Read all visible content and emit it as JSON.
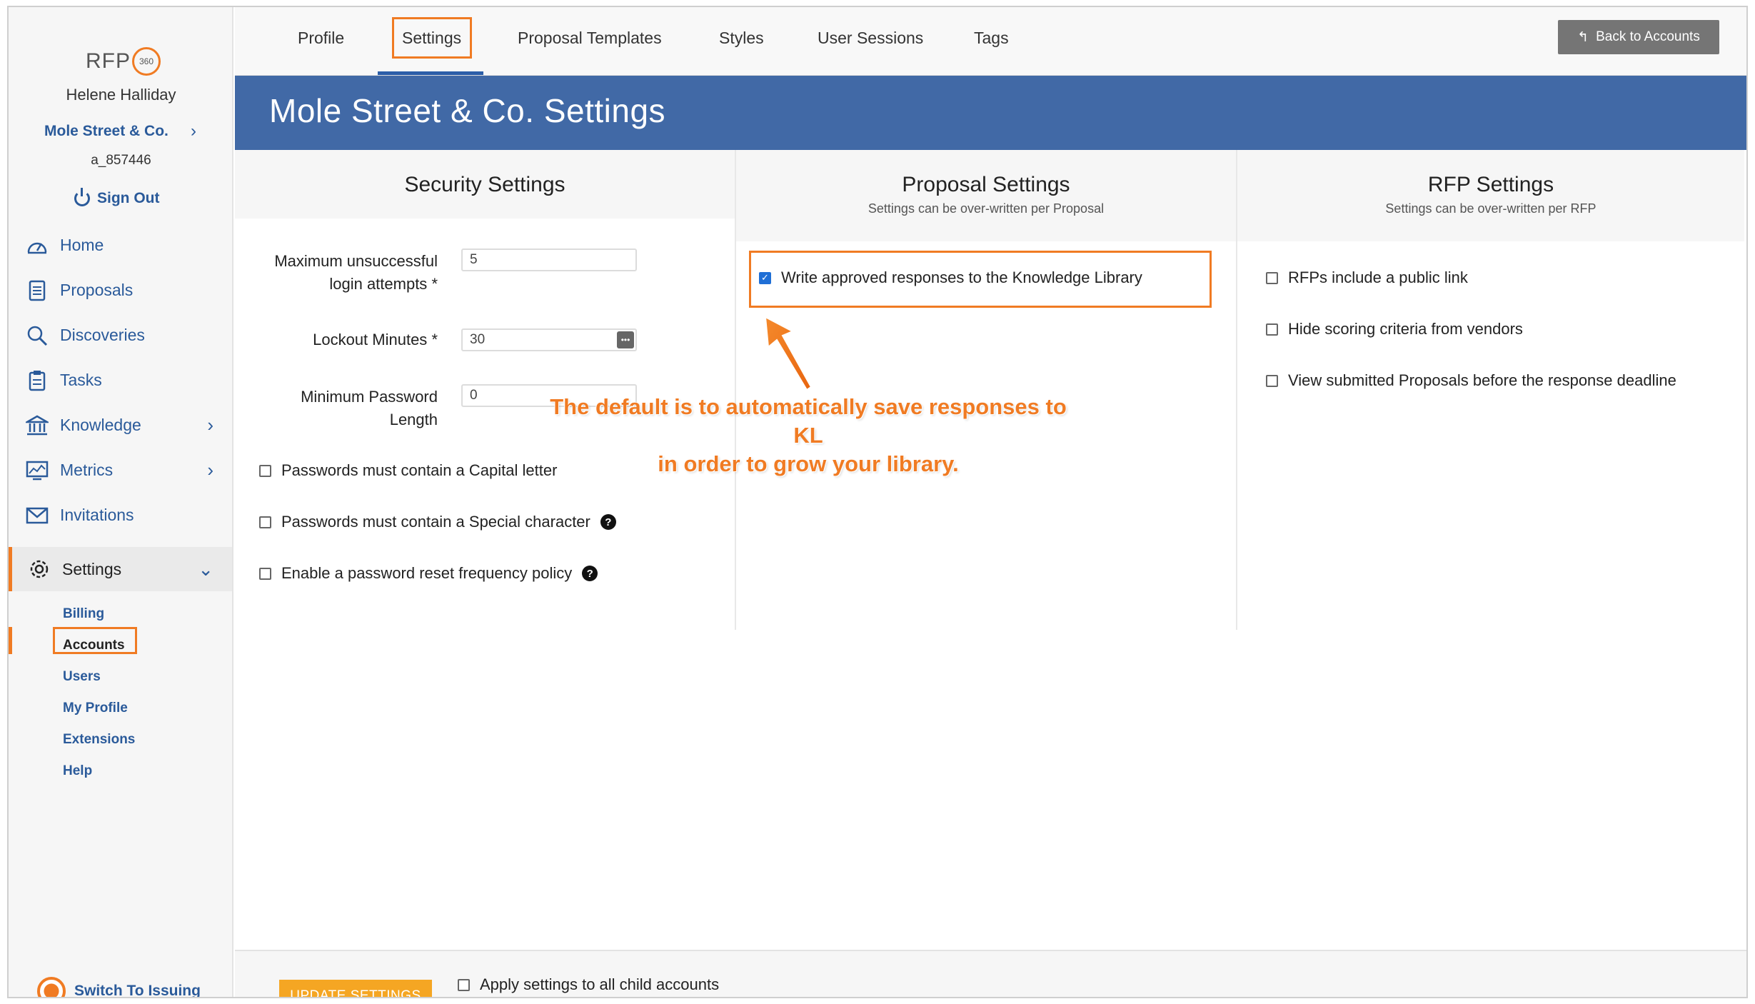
{
  "sidebar": {
    "logo_text": "RFP",
    "logo_badge": "360",
    "user_name": "Helene Halliday",
    "account_name": "Mole Street & Co.",
    "account_id": "a_857446",
    "sign_out": "Sign Out",
    "nav": [
      {
        "label": "Home",
        "icon": "speedometer-icon"
      },
      {
        "label": "Proposals",
        "icon": "document-icon"
      },
      {
        "label": "Discoveries",
        "icon": "search-icon"
      },
      {
        "label": "Tasks",
        "icon": "clipboard-icon"
      },
      {
        "label": "Knowledge",
        "icon": "bank-icon"
      },
      {
        "label": "Metrics",
        "icon": "chart-icon"
      },
      {
        "label": "Invitations",
        "icon": "envelope-icon"
      }
    ],
    "settings_label": "Settings",
    "sub": [
      "Billing",
      "Accounts",
      "Users",
      "My Profile",
      "Extensions",
      "Help"
    ],
    "switch_label": "Switch To Issuing"
  },
  "tabs": [
    "Profile",
    "Settings",
    "Proposal Templates",
    "Styles",
    "User Sessions",
    "Tags"
  ],
  "active_tab": "Settings",
  "back_button": "Back to Accounts",
  "page_title": "Mole Street & Co. Settings",
  "security": {
    "title": "Security Settings",
    "max_attempts_label_1": "Maximum unsuccessful",
    "max_attempts_label_2": "login attempts",
    "max_attempts_value": "5",
    "lockout_label": "Lockout Minutes",
    "lockout_value": "30",
    "min_pw_label_1": "Minimum Password",
    "min_pw_label_2": "Length",
    "min_pw_value": "0",
    "required_mark": "*",
    "checks": [
      {
        "label": "Passwords must contain a Capital letter",
        "checked": false
      },
      {
        "label": "Passwords must contain a Special character",
        "checked": false
      },
      {
        "label": "Enable a password reset frequency policy",
        "checked": false
      }
    ]
  },
  "proposal": {
    "title": "Proposal Settings",
    "subtitle": "Settings can be over-written per Proposal",
    "check_label": "Write approved responses to the Knowledge Library",
    "checked": true
  },
  "rfp": {
    "title": "RFP Settings",
    "subtitle": "Settings can be over-written per RFP",
    "checks": [
      {
        "label": "RFPs include a public link",
        "checked": false
      },
      {
        "label": "Hide scoring criteria from vendors",
        "checked": false
      },
      {
        "label": "View submitted Proposals before the response deadline",
        "checked": false
      }
    ]
  },
  "annotation": {
    "line1": "The default is to automatically save responses to KL",
    "line2": "in order to grow your library."
  },
  "footer": {
    "update_button": "UPDATE SETTINGS",
    "apply_child": "Apply settings to all child accounts"
  },
  "colors": {
    "accent": "#f07b23",
    "primary": "#4169a6",
    "link": "#2a5a9a"
  }
}
